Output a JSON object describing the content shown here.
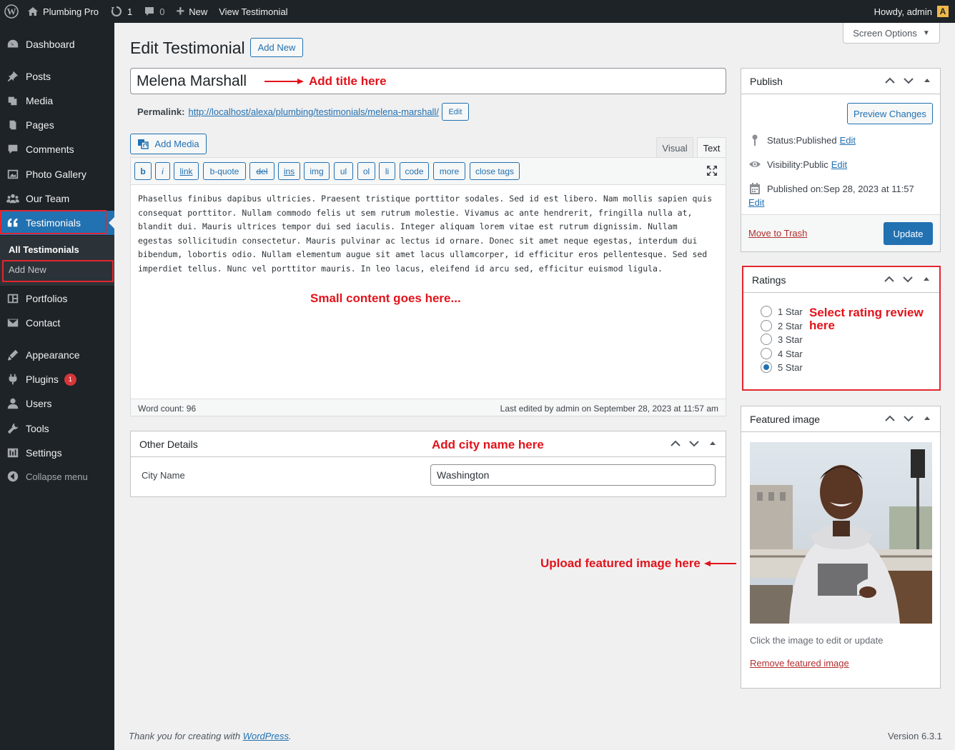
{
  "adminbar": {
    "site_name": "Plumbing Pro",
    "updates_count": "1",
    "comments_count": "0",
    "new_label": "New",
    "view_label": "View Testimonial",
    "howdy": "Howdy, admin"
  },
  "sidebar": {
    "items": [
      {
        "label": "Dashboard",
        "icon": "dashboard-icon"
      },
      {
        "label": "Posts",
        "icon": "pin-icon"
      },
      {
        "label": "Media",
        "icon": "media-icon"
      },
      {
        "label": "Pages",
        "icon": "pages-icon"
      },
      {
        "label": "Comments",
        "icon": "comments-icon"
      },
      {
        "label": "Photo Gallery",
        "icon": "gallery-icon"
      },
      {
        "label": "Our Team",
        "icon": "groups-icon"
      },
      {
        "label": "Testimonials",
        "icon": "quote-icon"
      },
      {
        "label": "Portfolios",
        "icon": "portfolio-icon"
      },
      {
        "label": "Contact",
        "icon": "email-icon"
      },
      {
        "label": "Appearance",
        "icon": "brush-icon"
      },
      {
        "label": "Plugins",
        "icon": "plugin-icon"
      },
      {
        "label": "Users",
        "icon": "users-icon"
      },
      {
        "label": "Tools",
        "icon": "wrench-icon"
      },
      {
        "label": "Settings",
        "icon": "settings-icon"
      },
      {
        "label": "Collapse menu",
        "icon": "collapse-icon"
      }
    ],
    "submenu": {
      "all": "All Testimonials",
      "add_new": "Add New"
    },
    "plugins_badge": "1"
  },
  "page": {
    "title": "Edit Testimonial",
    "add_new": "Add New",
    "screen_options": "Screen Options",
    "post_title": "Melena Marshall",
    "permalink_label": "Permalink:",
    "permalink_base": "http://localhost/alexa/plumbing/testimonials/",
    "permalink_slug": "melena-marshall",
    "permalink_end": "/",
    "permalink_edit": "Edit"
  },
  "annotations": {
    "title": "Add title here",
    "content": "Small content goes here...",
    "city": "Add city name here",
    "rating_1": "Select rating review",
    "rating_2": "here",
    "image": "Upload featured image here"
  },
  "editor": {
    "add_media": "Add Media",
    "tab_visual": "Visual",
    "tab_text": "Text",
    "quicktags": [
      "b",
      "i",
      "link",
      "b-quote",
      "del",
      "ins",
      "img",
      "ul",
      "ol",
      "li",
      "code",
      "more",
      "close tags"
    ],
    "content_lines": [
      "Phasellus finibus dapibus ultricies. Praesent tristique porttitor sodales. Sed id est libero. Nam mollis sapien quis",
      "consequat porttitor. Nullam commodo felis ut sem rutrum molestie. Vivamus ac ante hendrerit, fringilla nulla at,",
      "blandit dui. Mauris ultrices tempor dui sed iaculis. Integer aliquam lorem vitae est rutrum dignissim. Nullam",
      "egestas sollicitudin consectetur. Mauris pulvinar ac lectus id ornare. Donec sit amet neque egestas, interdum dui",
      "bibendum, lobortis odio. Nullam elementum augue sit amet lacus ullamcorper, id efficitur eros pellentesque. Sed sed",
      "imperdiet tellus. Nunc vel porttitor mauris. In leo lacus, eleifend id arcu sed, efficitur euismod ligula."
    ],
    "word_count": "Word count: 96",
    "last_edited": "Last edited by admin on September 28, 2023 at 11:57 am"
  },
  "other_details": {
    "title": "Other Details",
    "city_label": "City Name",
    "city_value": "Washington"
  },
  "publish": {
    "title": "Publish",
    "preview": "Preview Changes",
    "status_label": "Status: ",
    "status_value": "Published",
    "visibility_label": "Visibility: ",
    "visibility_value": "Public",
    "published_label": "Published on: ",
    "published_value": "Sep 28, 2023 at 11:57",
    "edit": "Edit",
    "trash": "Move to Trash",
    "update": "Update"
  },
  "ratings": {
    "title": "Ratings",
    "options": [
      "1 Star",
      "2 Star",
      "3 Star",
      "4 Star",
      "5 Star"
    ],
    "selected": "5 Star"
  },
  "featured": {
    "title": "Featured image",
    "hint": "Click the image to edit or update",
    "remove": "Remove featured image"
  },
  "footer": {
    "thanks_prefix": "Thank you for creating with ",
    "wp_link": "WordPress",
    "thanks_suffix": ".",
    "version": "Version 6.3.1"
  },
  "colors": {
    "accent": "#2271b1",
    "annotation": "#e2131b",
    "adminbar": "#1d2327"
  }
}
